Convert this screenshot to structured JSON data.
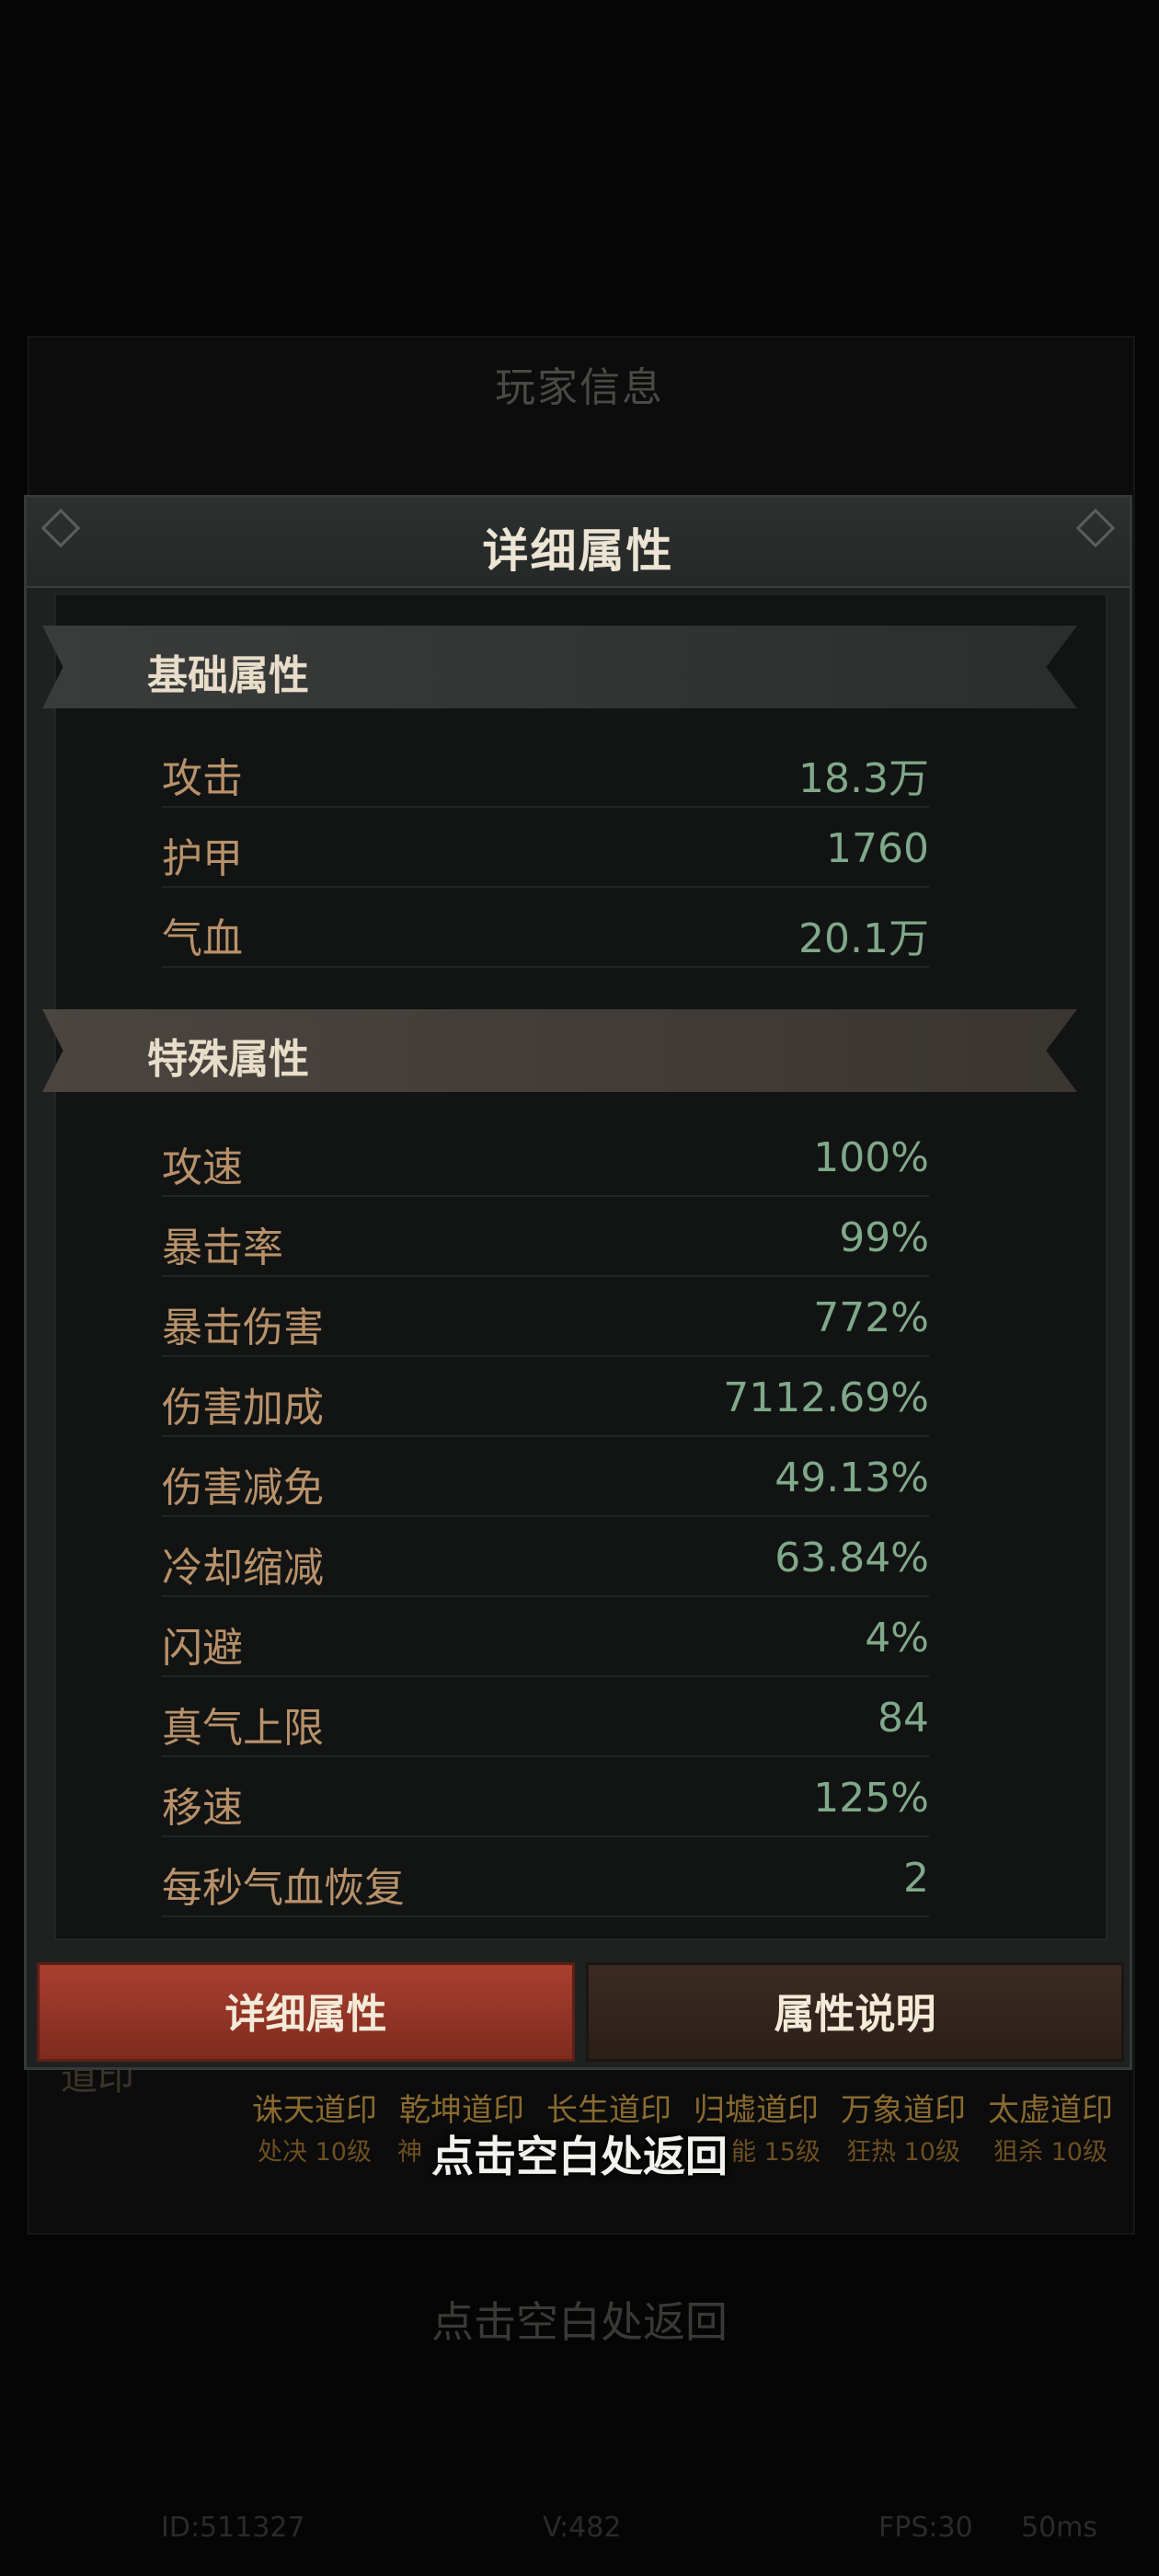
{
  "background": {
    "title": "玩家信息",
    "dao_heading": "道印",
    "seals": [
      {
        "name": "诛天道印",
        "sub": "处决 10级"
      },
      {
        "name": "乾坤道印",
        "sub": "神"
      },
      {
        "name": "长生道印",
        "sub": ""
      },
      {
        "name": "归墟道印",
        "sub": "能 15级"
      },
      {
        "name": "万象道印",
        "sub": "狂热 10级"
      },
      {
        "name": "太虚道印",
        "sub": "狙杀 10级"
      }
    ],
    "back_hint": "点击空白处返回",
    "footer": {
      "id": "ID:511327",
      "version": "V:482",
      "fps": "FPS:30",
      "latency": "50ms"
    }
  },
  "dialog": {
    "title": "详细属性",
    "basic_section_title": "基础属性",
    "basic_stats": [
      {
        "label": "攻击",
        "value": "18.3万"
      },
      {
        "label": "护甲",
        "value": "1760"
      },
      {
        "label": "气血",
        "value": "20.1万"
      }
    ],
    "special_section_title": "特殊属性",
    "special_stats": [
      {
        "label": "攻速",
        "value": "100%"
      },
      {
        "label": "暴击率",
        "value": "99%"
      },
      {
        "label": "暴击伤害",
        "value": "772%"
      },
      {
        "label": "伤害加成",
        "value": "7112.69%"
      },
      {
        "label": "伤害减免",
        "value": "49.13%"
      },
      {
        "label": "冷却缩减",
        "value": "63.84%"
      },
      {
        "label": "闪避",
        "value": "4%"
      },
      {
        "label": "真气上限",
        "value": "84"
      },
      {
        "label": "移速",
        "value": "125%"
      },
      {
        "label": "每秒气血恢复",
        "value": "2"
      }
    ],
    "buttons": {
      "detail": "详细属性",
      "explain": "属性说明"
    }
  },
  "back_hint": "点击空白处返回"
}
